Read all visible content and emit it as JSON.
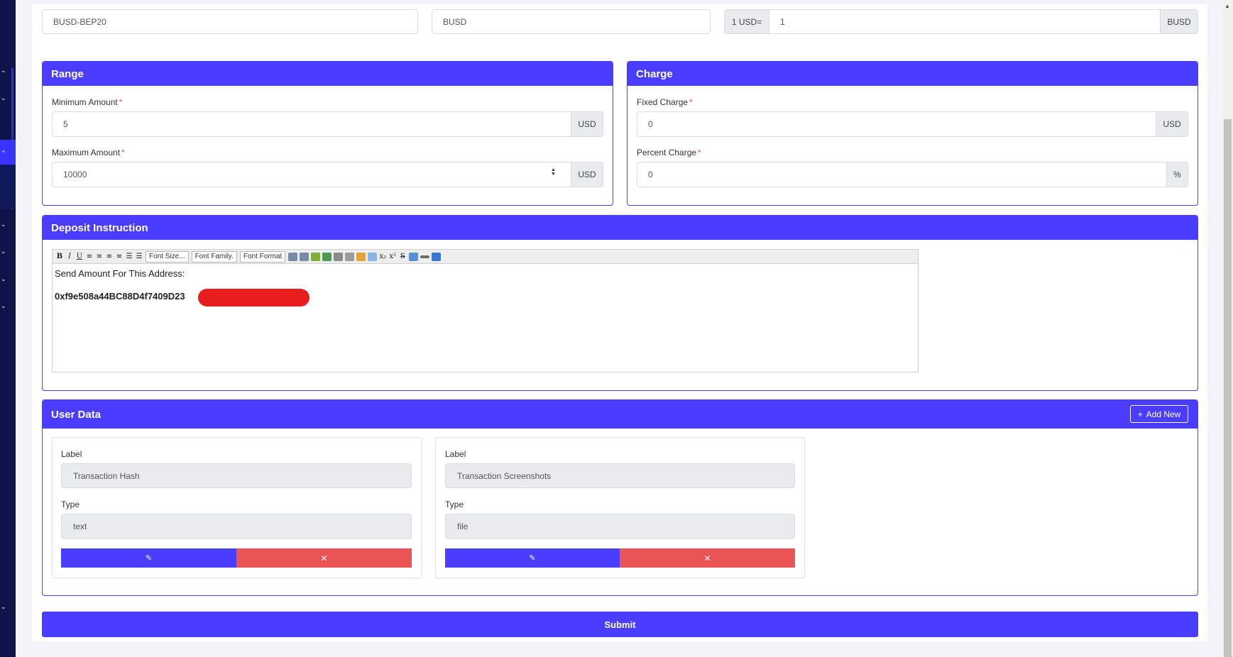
{
  "top_row": {
    "currency_value": "BUSD-BEP20",
    "symbol_value": "BUSD",
    "rate_prefix": "1 USD=",
    "rate_value": "1",
    "rate_suffix": "BUSD"
  },
  "range": {
    "title": "Range",
    "min_label": "Minimum Amount",
    "min_value": "5",
    "min_unit": "USD",
    "max_label": "Maximum Amount",
    "max_value": "10000",
    "max_unit": "USD",
    "required_mark": "*"
  },
  "charge": {
    "title": "Charge",
    "fixed_label": "Fixed Charge",
    "fixed_value": "0",
    "fixed_unit": "USD",
    "percent_label": "Percent Charge",
    "percent_value": "0",
    "percent_unit": "%"
  },
  "deposit": {
    "title": "Deposit Instruction",
    "toolbar": {
      "bold": "B",
      "italic": "I",
      "underline": "U",
      "font_size": "Font Size...",
      "font_family": "Font Family.",
      "font_format": "Font Format"
    },
    "line1": "Send Amount For This Address:",
    "address": "0xf9e508a44BC88D4f7409D23"
  },
  "user_data": {
    "title": "User Data",
    "add_new": "Add New",
    "label_caption": "Label",
    "type_caption": "Type",
    "items": [
      {
        "label": "Transaction Hash",
        "type": "text"
      },
      {
        "label": "Transaction Screenshots",
        "type": "file"
      }
    ]
  },
  "submit_label": "Submit",
  "colors": {
    "primary": "#4b3dfd",
    "danger": "#ea5455",
    "sidebar": "#0c1449"
  }
}
